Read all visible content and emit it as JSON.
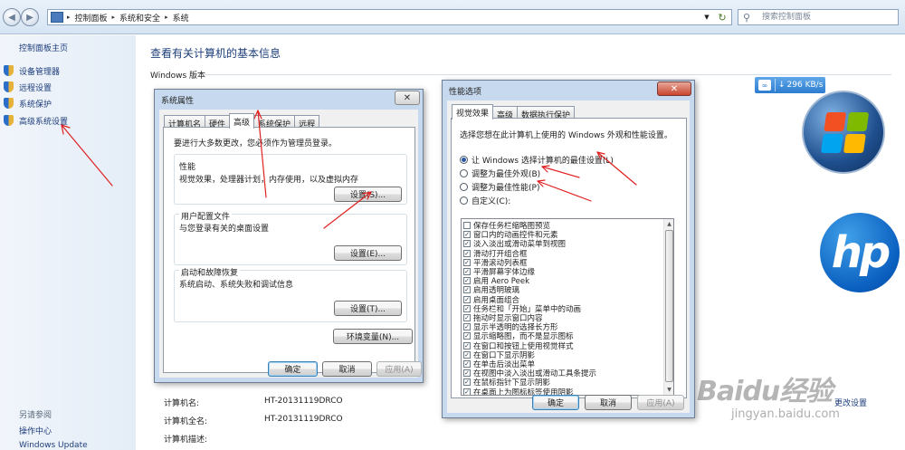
{
  "address_bar": {
    "breadcrumbs": [
      "控制面板",
      "系统和安全",
      "系统"
    ],
    "search_placeholder": "搜索控制面板"
  },
  "left_pane": {
    "home": "控制面板主页",
    "links": [
      "设备管理器",
      "远程设置",
      "系统保护",
      "高级系统设置"
    ],
    "see_also_title": "另请参阅",
    "see_also_links": [
      "操作中心",
      "Windows Update"
    ]
  },
  "main": {
    "title": "查看有关计算机的基本信息",
    "windows_version_label": "Windows 版本",
    "speed_badge": "296 KB/s",
    "change_settings": "更改设置",
    "computer_rows": [
      {
        "label": "计算机名:",
        "value": "HT-20131119DRCO"
      },
      {
        "label": "计算机全名:",
        "value": "HT-20131119DRCO"
      },
      {
        "label": "计算机描述:",
        "value": ""
      }
    ]
  },
  "sys_props": {
    "title": "系统属性",
    "tabs": [
      "计算机名",
      "硬件",
      "高级",
      "系统保护",
      "远程"
    ],
    "active_tab": "高级",
    "admin_note": "要进行大多数更改，您必须作为管理员登录。",
    "perf_title": "性能",
    "perf_desc": "视觉效果，处理器计划，内存使用，以及虚拟内存",
    "settings_label": "设置(S)...",
    "profile_title": "用户配置文件",
    "profile_desc": "与您登录有关的桌面设置",
    "profile_settings_label": "设置(E)...",
    "startup_title": "启动和故障恢复",
    "startup_desc": "系统启动、系统失败和调试信息",
    "startup_settings_label": "设置(T)...",
    "env_vars_label": "环境变量(N)...",
    "ok_label": "确定",
    "cancel_label": "取消",
    "apply_label": "应用(A)"
  },
  "perf_opts": {
    "title": "性能选项",
    "tabs": [
      "视觉效果",
      "高级",
      "数据执行保护"
    ],
    "active_tab": "视觉效果",
    "instruction": "选择您想在此计算机上使用的 Windows 外观和性能设置。",
    "radios": [
      {
        "label": "让 Windows 选择计算机的最佳设置(L)",
        "checked": true
      },
      {
        "label": "调整为最佳外观(B)",
        "checked": false
      },
      {
        "label": "调整为最佳性能(P)",
        "checked": false
      },
      {
        "label": "自定义(C):",
        "checked": false
      }
    ],
    "effects": [
      {
        "label": "保存任务栏缩略图预览",
        "checked": false
      },
      {
        "label": "窗口内的动画控件和元素",
        "checked": true
      },
      {
        "label": "淡入淡出或滑动菜单到视图",
        "checked": true
      },
      {
        "label": "滑动打开组合框",
        "checked": true
      },
      {
        "label": "平滑滚动列表框",
        "checked": true
      },
      {
        "label": "平滑屏幕字体边缘",
        "checked": true
      },
      {
        "label": "启用 Aero Peek",
        "checked": true
      },
      {
        "label": "启用透明玻璃",
        "checked": true
      },
      {
        "label": "启用桌面组合",
        "checked": true
      },
      {
        "label": "任务栏和「开始」菜单中的动画",
        "checked": true
      },
      {
        "label": "拖动时显示窗口内容",
        "checked": true
      },
      {
        "label": "显示半透明的选择长方形",
        "checked": true
      },
      {
        "label": "显示缩略图，而不是显示图标",
        "checked": true
      },
      {
        "label": "在窗口和按钮上使用视觉样式",
        "checked": true
      },
      {
        "label": "在窗口下显示阴影",
        "checked": true
      },
      {
        "label": "在单击后淡出菜单",
        "checked": true
      },
      {
        "label": "在视图中淡入淡出或滑动工具条提示",
        "checked": true
      },
      {
        "label": "在鼠标指针下显示阴影",
        "checked": true
      },
      {
        "label": "在桌面上为图标标签使用阴影",
        "checked": true
      }
    ],
    "ok_label": "确定",
    "cancel_label": "取消",
    "apply_label": "应用(A)"
  },
  "watermark": {
    "brand": "Baidu经验",
    "url": "jingyan.baidu.com"
  },
  "colors": {
    "link": "#1d3d7a",
    "title": "#1e3f7a",
    "annotation_arrow": "#e02020"
  }
}
